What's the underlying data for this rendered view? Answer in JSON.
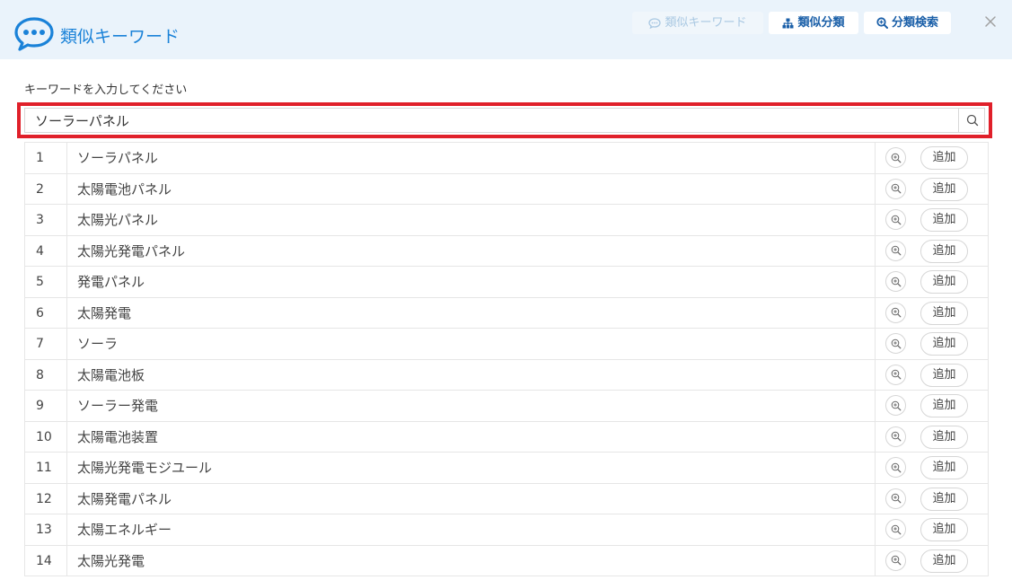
{
  "header": {
    "app_title": "類似キーワード",
    "buttons": {
      "similar_keywords": "類似キーワード",
      "similar_classification": "類似分類",
      "classification_search": "分類検索"
    }
  },
  "search": {
    "prompt": "キーワードを入力してください",
    "value": "ソーラーパネル"
  },
  "results": [
    {
      "num": "1",
      "keyword": "ソーラパネル",
      "add_label": "追加"
    },
    {
      "num": "2",
      "keyword": "太陽電池パネル",
      "add_label": "追加"
    },
    {
      "num": "3",
      "keyword": "太陽光パネル",
      "add_label": "追加"
    },
    {
      "num": "4",
      "keyword": "太陽光発電パネル",
      "add_label": "追加"
    },
    {
      "num": "5",
      "keyword": "発電パネル",
      "add_label": "追加"
    },
    {
      "num": "6",
      "keyword": "太陽発電",
      "add_label": "追加"
    },
    {
      "num": "7",
      "keyword": "ソーラ",
      "add_label": "追加"
    },
    {
      "num": "8",
      "keyword": "太陽電池板",
      "add_label": "追加"
    },
    {
      "num": "9",
      "keyword": "ソーラー発電",
      "add_label": "追加"
    },
    {
      "num": "10",
      "keyword": "太陽電池装置",
      "add_label": "追加"
    },
    {
      "num": "11",
      "keyword": "太陽光発電モジユール",
      "add_label": "追加"
    },
    {
      "num": "12",
      "keyword": "太陽発電パネル",
      "add_label": "追加"
    },
    {
      "num": "13",
      "keyword": "太陽エネルギー",
      "add_label": "追加"
    },
    {
      "num": "14",
      "keyword": "太陽光発電",
      "add_label": "追加"
    }
  ],
  "colors": {
    "accent": "#1a82d8",
    "header_bg": "#eaf3fb",
    "highlight_border": "#e0202a"
  },
  "icons": {
    "logo": "chat-bubble-icon",
    "similar_keywords": "chat-icon",
    "similar_classification": "sitemap-icon",
    "classification_search": "zoom-search-icon",
    "close": "close-icon",
    "search": "search-icon",
    "row_zoom": "zoom-in-icon"
  }
}
